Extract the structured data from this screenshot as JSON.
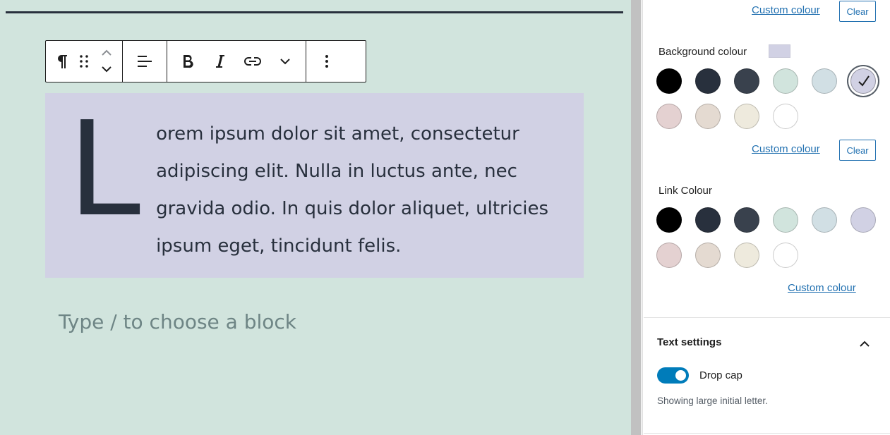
{
  "editor": {
    "paragraph": {
      "drop_cap": "L",
      "text": "orem ipsum dolor sit amet, consectetur adipiscing elit. Nulla in luctus ante, nec gravida odio. In quis dolor aliquet, ultricies ipsum eget, tincidunt felis."
    },
    "placeholder": "Type / to choose a block",
    "colors": {
      "canvas": "#d1e4dd",
      "block_background": "#d1d1e4",
      "text": "#28303d"
    }
  },
  "toolbar": {
    "buttons": [
      "paragraph-icon",
      "drag-handle-icon",
      "move-up-icon",
      "move-down-icon",
      "align-left-icon",
      "bold-icon",
      "italic-icon",
      "link-icon",
      "more-rich-text-icon",
      "options-icon"
    ]
  },
  "sidebar": {
    "text_colour": {
      "custom_label": "Custom colour",
      "clear_label": "Clear"
    },
    "background_colour": {
      "label": "Background colour",
      "custom_label": "Custom colour",
      "clear_label": "Clear",
      "selected": "#d1d1e4"
    },
    "link_colour": {
      "label": "Link Colour",
      "custom_label": "Custom colour"
    },
    "palette": [
      "#000000",
      "#28303d",
      "#39414d",
      "#d1e4dd",
      "#d1dfe4",
      "#d1d1e4",
      "#e4d1d1",
      "#e4dad1",
      "#eeeadd",
      "#ffffff"
    ],
    "text_settings": {
      "title": "Text settings",
      "drop_cap_label": "Drop cap",
      "drop_cap_enabled": true,
      "drop_cap_help": "Showing large initial letter."
    }
  }
}
